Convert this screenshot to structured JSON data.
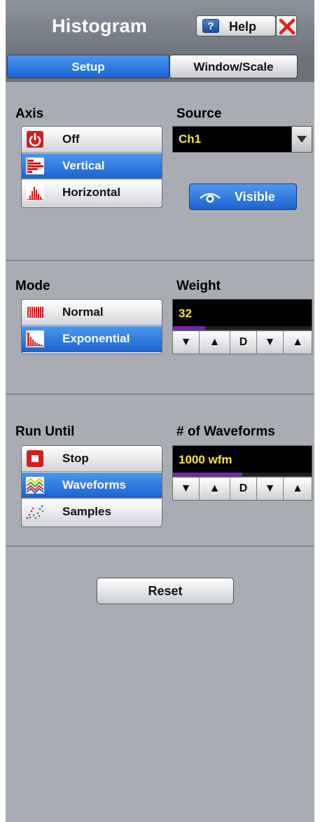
{
  "header": {
    "title": "Histogram",
    "help_label": "Help",
    "help_icon": "help-book-icon",
    "close_icon": "close-x-icon"
  },
  "tabs": [
    {
      "label": "Setup",
      "active": true
    },
    {
      "label": "Window/Scale",
      "active": false
    }
  ],
  "axis": {
    "label": "Axis",
    "options": [
      {
        "label": "Off",
        "icon": "power-icon",
        "selected": false
      },
      {
        "label": "Vertical",
        "icon": "vertical-histogram-icon",
        "selected": true
      },
      {
        "label": "Horizontal",
        "icon": "horizontal-histogram-icon",
        "selected": false
      }
    ]
  },
  "source": {
    "label": "Source",
    "value": "Ch1",
    "visible_label": "Visible",
    "visible_icon": "eye-icon"
  },
  "mode": {
    "label": "Mode",
    "options": [
      {
        "label": "Normal",
        "icon": "normal-mode-icon",
        "selected": false
      },
      {
        "label": "Exponential",
        "icon": "exponential-mode-icon",
        "selected": true
      }
    ]
  },
  "weight": {
    "label": "Weight",
    "value": "32",
    "fill_fraction": 0.23,
    "stepper": [
      "▼",
      "▲",
      "D",
      "▼",
      "▲"
    ]
  },
  "run_until": {
    "label": "Run Until",
    "options": [
      {
        "label": "Stop",
        "icon": "stop-icon",
        "selected": false
      },
      {
        "label": "Waveforms",
        "icon": "waveforms-icon",
        "selected": true
      },
      {
        "label": "Samples",
        "icon": "samples-icon",
        "selected": false
      }
    ]
  },
  "waveforms": {
    "label": "# of Waveforms",
    "value": "1000 wfm",
    "fill_fraction": 0.5,
    "stepper": [
      "▼",
      "▲",
      "D",
      "▼",
      "▲"
    ]
  },
  "reset_label": "Reset",
  "colors": {
    "panel": "#a9acb3",
    "selected": "#2a74dd",
    "field_text": "#f4e63a",
    "progress": "#7c22b6"
  }
}
